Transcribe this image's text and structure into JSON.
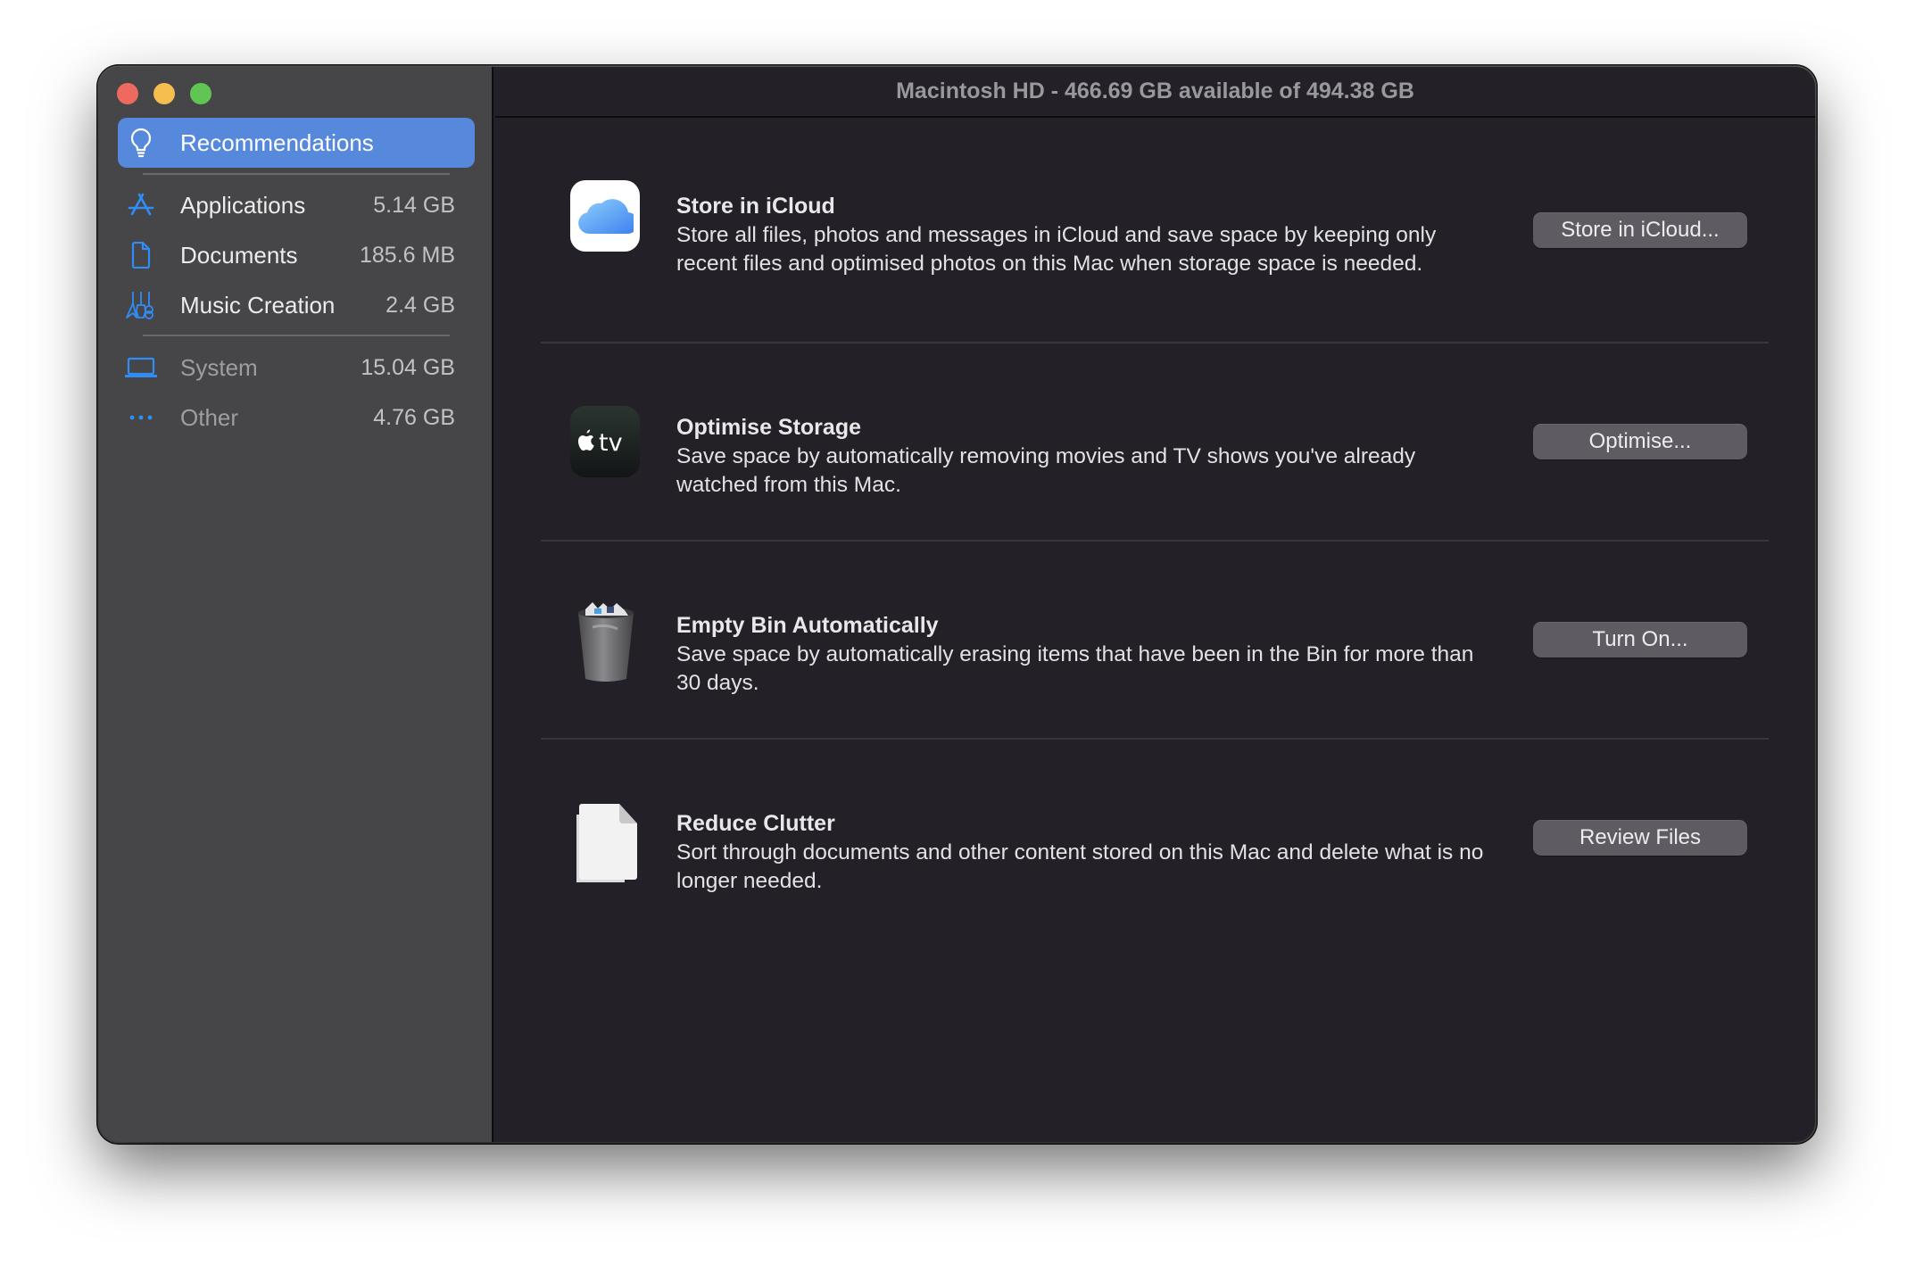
{
  "window": {
    "title": "Macintosh HD - 466.69 GB available of 494.38 GB",
    "traffic_lights": [
      "close",
      "minimise",
      "zoom"
    ]
  },
  "sidebar": {
    "items": [
      {
        "label": "Recommendations",
        "size": "",
        "icon": "lightbulb-icon",
        "selected": true
      },
      {
        "label": "Applications",
        "size": "5.14 GB",
        "icon": "app-store-icon"
      },
      {
        "label": "Documents",
        "size": "185.6 MB",
        "icon": "document-icon"
      },
      {
        "label": "Music Creation",
        "size": "2.4 GB",
        "icon": "guitars-icon"
      },
      {
        "label": "System",
        "size": "15.04 GB",
        "icon": "laptop-icon",
        "dimmed": true
      },
      {
        "label": "Other",
        "size": "4.76 GB",
        "icon": "ellipsis-icon",
        "dimmed": true
      }
    ]
  },
  "recommendations": [
    {
      "title": "Store in iCloud",
      "description": "Store all files, photos and messages in iCloud and save space by keeping only recent files and optimised photos on this Mac when storage space is needed.",
      "button": "Store in iCloud...",
      "icon": "icloud-icon"
    },
    {
      "title": "Optimise Storage",
      "description": "Save space by automatically removing movies and TV shows you've already watched from this Mac.",
      "button": "Optimise...",
      "icon": "apple-tv-icon",
      "icon_text": "tv"
    },
    {
      "title": "Empty Bin Automatically",
      "description": "Save space by automatically erasing items that have been in the Bin for more than 30 days.",
      "button": "Turn On...",
      "icon": "trash-bin-icon"
    },
    {
      "title": "Reduce Clutter",
      "description": "Sort through documents and other content stored on this Mac and delete what is no longer needed.",
      "button": "Review Files",
      "icon": "documents-icon"
    }
  ],
  "colors": {
    "accent": "#5688dc",
    "sidebar_bg": "#464649",
    "content_bg": "#232127",
    "icon_blue": "#2f8df5"
  }
}
